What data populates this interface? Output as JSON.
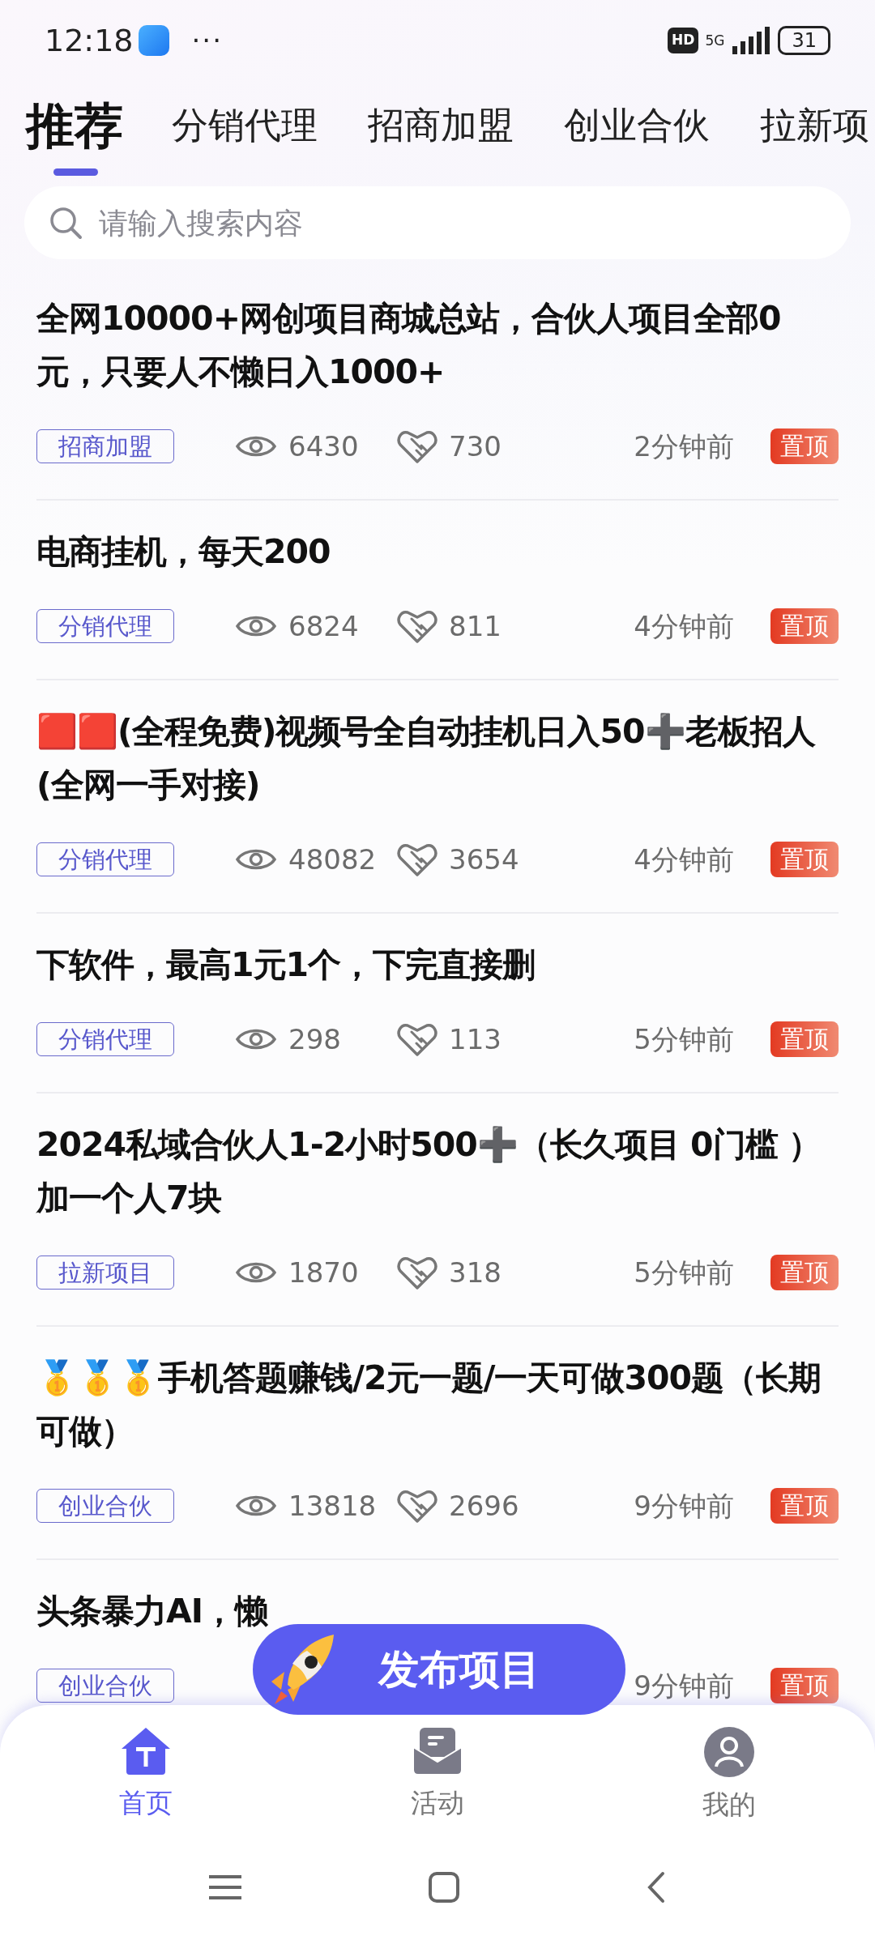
{
  "status_bar": {
    "time": "12:18",
    "more": "···",
    "hd": "HD",
    "network": "5G",
    "battery": "31"
  },
  "tabs": [
    {
      "label": "推荐",
      "selected": true
    },
    {
      "label": "分销代理",
      "selected": false
    },
    {
      "label": "招商加盟",
      "selected": false
    },
    {
      "label": "创业合伙",
      "selected": false
    },
    {
      "label": "拉新项",
      "selected": false
    }
  ],
  "search": {
    "placeholder": "请输入搜索内容"
  },
  "posts": [
    {
      "title": "全网10000+网创项目商城总站，合伙人项目全部0元，只要人不懒日入1000+",
      "tag": "招商加盟",
      "views": "6430",
      "likes": "730",
      "time": "2分钟前",
      "badge": "置顶"
    },
    {
      "title": "电商挂机，每天200",
      "tag": "分销代理",
      "views": "6824",
      "likes": "811",
      "time": "4分钟前",
      "badge": "置顶"
    },
    {
      "title": "🟥🟥(全程免费)视频号全自动挂机日入50➕老板招人(全网一手对接)",
      "tag": "分销代理",
      "views": "48082",
      "likes": "3654",
      "time": "4分钟前",
      "badge": "置顶"
    },
    {
      "title": "下软件，最高1元1个，下完直接删",
      "tag": "分销代理",
      "views": "298",
      "likes": "113",
      "time": "5分钟前",
      "badge": "置顶"
    },
    {
      "title": "2024私域合伙人1-2小时500➕（长久项目 0门槛 ）加一个人7块",
      "tag": "拉新项目",
      "views": "1870",
      "likes": "318",
      "time": "5分钟前",
      "badge": "置顶"
    },
    {
      "title": "🥇🥇🥇手机答题赚钱/2元一题/一天可做300题（长期可做）",
      "tag": "创业合伙",
      "views": "13818",
      "likes": "2696",
      "time": "9分钟前",
      "badge": "置顶"
    },
    {
      "title": "头条暴力AI，懒",
      "tag": "创业合伙",
      "time": "9分钟前",
      "badge": "置顶"
    }
  ],
  "fab": {
    "label": "发布项目"
  },
  "bottom_nav": [
    {
      "label": "首页",
      "kind": "home",
      "selected": true
    },
    {
      "label": "活动",
      "kind": "mail",
      "selected": false
    },
    {
      "label": "我的",
      "kind": "user",
      "selected": false
    }
  ]
}
